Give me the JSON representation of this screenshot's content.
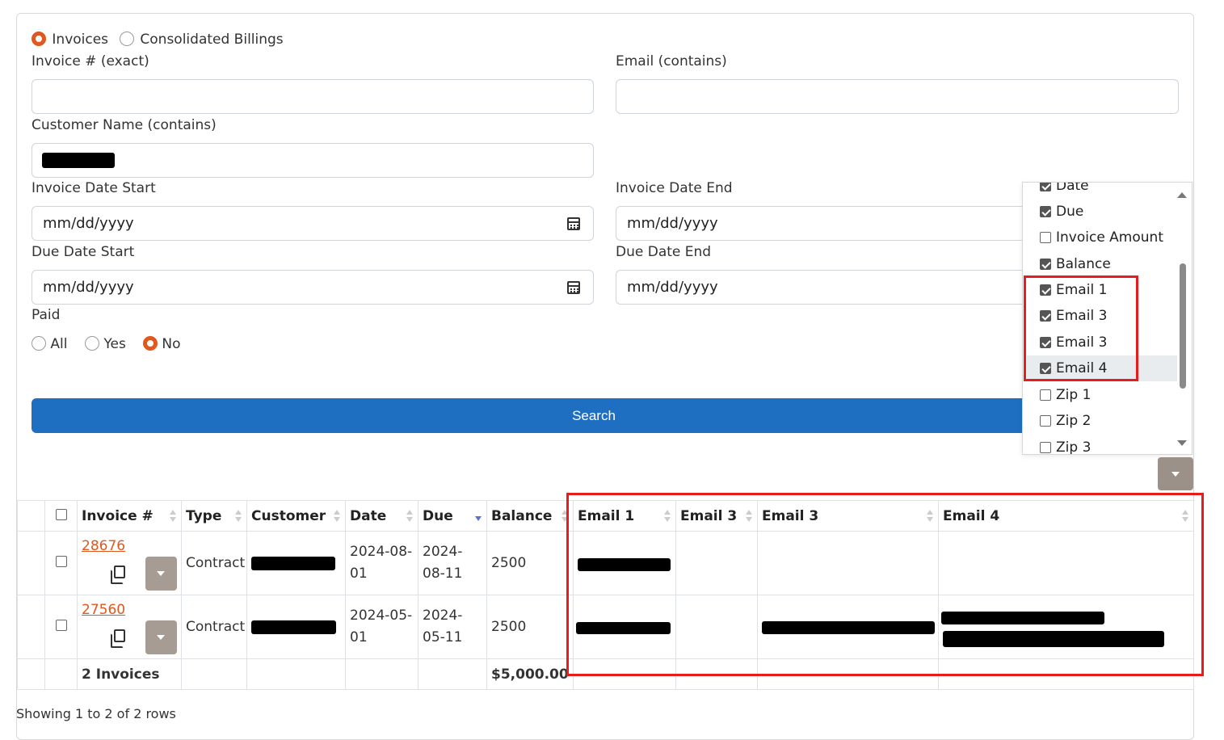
{
  "mode": {
    "options": [
      {
        "label": "Invoices",
        "selected": true
      },
      {
        "label": "Consolidated Billings",
        "selected": false
      }
    ]
  },
  "filters": {
    "invoice_label": "Invoice # (exact)",
    "email_label": "Email (contains)",
    "customer_label": "Customer Name (contains)",
    "invoice_date_start_label": "Invoice Date Start",
    "invoice_date_end_label": "Invoice Date End",
    "due_date_start_label": "Due Date Start",
    "due_date_end_label": "Due Date End",
    "date_placeholder": "mm/dd/yyyy",
    "paid_label": "Paid",
    "paid_options": [
      {
        "label": "All",
        "selected": false
      },
      {
        "label": "Yes",
        "selected": false
      },
      {
        "label": "No",
        "selected": true
      }
    ]
  },
  "search_label": "Search",
  "columns_menu": {
    "items": [
      {
        "label": "Date",
        "checked": true
      },
      {
        "label": "Due",
        "checked": true
      },
      {
        "label": "Invoice Amount",
        "checked": false
      },
      {
        "label": "Balance",
        "checked": true
      },
      {
        "label": "Email 1",
        "checked": true
      },
      {
        "label": "Email 3",
        "checked": true
      },
      {
        "label": "Email 3",
        "checked": true
      },
      {
        "label": "Email 4",
        "checked": true
      },
      {
        "label": "Zip 1",
        "checked": false
      },
      {
        "label": "Zip 2",
        "checked": false
      },
      {
        "label": "Zip 3",
        "checked": false
      }
    ]
  },
  "table": {
    "headers": [
      "Invoice #",
      "Type",
      "Customer",
      "Date",
      "Due",
      "Balance",
      "Email 1",
      "Email 3",
      "Email 3",
      "Email 4"
    ],
    "rows": [
      {
        "invoice": "28676",
        "type": "Contract",
        "date": "2024-08-01",
        "due": "2024-08-11",
        "balance": "2500"
      },
      {
        "invoice": "27560",
        "type": "Contract",
        "date": "2024-05-01",
        "due": "2024-05-11",
        "balance": "2500"
      }
    ],
    "footer": {
      "count": "2 Invoices",
      "total": "$5,000.00"
    }
  },
  "status_text": "Showing 1 to 2 of 2 rows",
  "colors": {
    "accent": "#e2571e",
    "primary": "#1e6fc2",
    "highlight": "#e81c1c"
  }
}
